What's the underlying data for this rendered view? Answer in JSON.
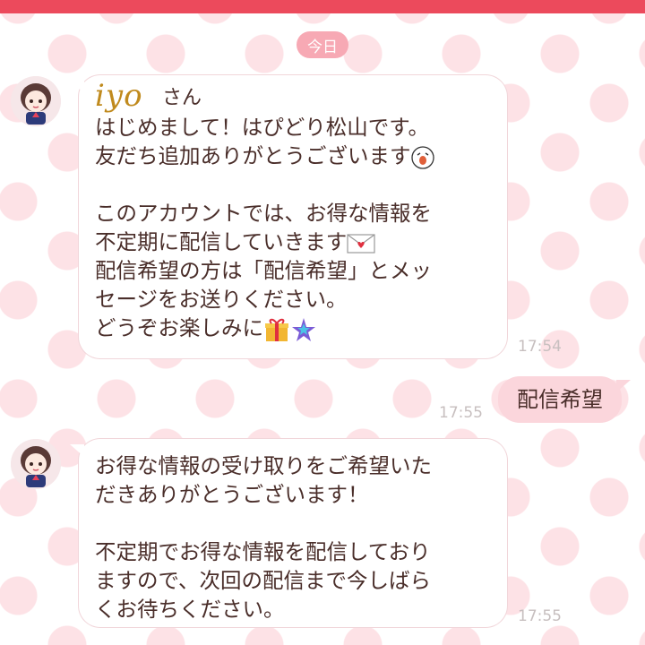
{
  "header": {
    "date_label": "今日"
  },
  "messages": {
    "m1": {
      "name": "iyo",
      "name_suffix": "さん",
      "lines": {
        "l1": "はじめまして！はぴどり松山です。",
        "l2": "友だち追加ありがとうございます",
        "l3": "このアカウントでは、お得な情報を",
        "l4": "不定期に配信していきます",
        "l5": "配信希望の方は「配信希望」とメッ",
        "l6": "セージをお送りください。",
        "l7": "どうぞお楽しみに"
      },
      "time": "17:54"
    },
    "m2": {
      "text": "配信希望",
      "time": "17:55"
    },
    "m3": {
      "lines": {
        "l1": "お得な情報の受け取りをご希望いた",
        "l2": "だきありがとうございます！",
        "l3": "不定期でお得な情報を配信しており",
        "l4": "ますので、次回の配信まで今しばら",
        "l5": "くお待ちください。"
      },
      "time": "17:55"
    }
  },
  "icons": [
    "face-emoji-icon",
    "envelope-heart-icon",
    "gift-icon",
    "sparkle-star-icon"
  ]
}
